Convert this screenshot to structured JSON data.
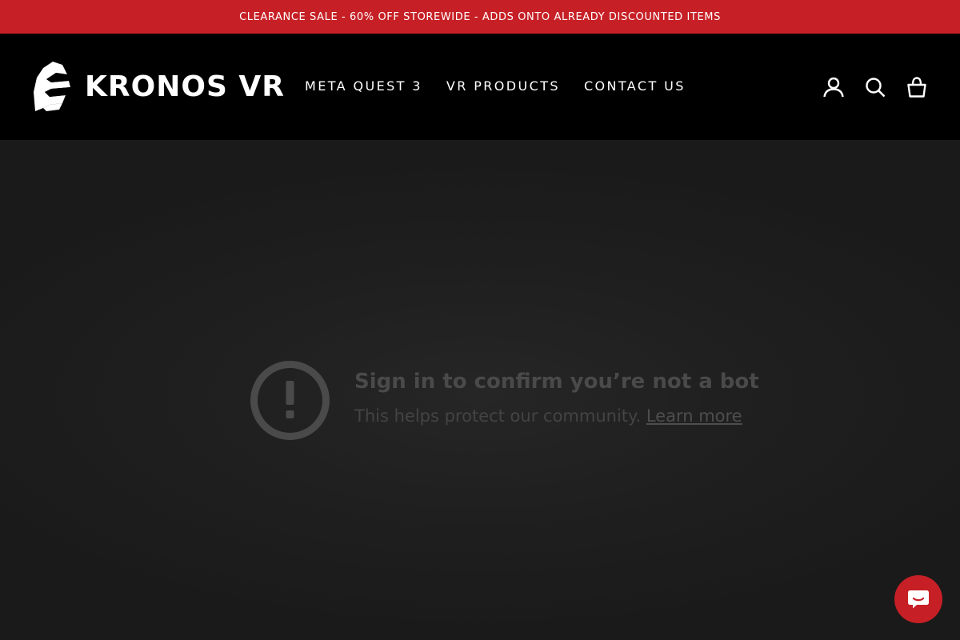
{
  "announcement": {
    "text": "CLEARANCE SALE - 60% OFF STOREWIDE - ADDS ONTO ALREADY DISCOUNTED ITEMS"
  },
  "header": {
    "logo_text": "KRONOS VR",
    "nav": [
      {
        "label": "META QUEST 3"
      },
      {
        "label": "VR PRODUCTS"
      },
      {
        "label": "CONTACT US"
      }
    ],
    "icons": {
      "account": "user-icon",
      "search": "search-icon",
      "cart": "cart-icon"
    }
  },
  "embed": {
    "icon": "alert-icon",
    "title": "Sign in to confirm you’re not a bot",
    "subtitle": "This helps protect our community.",
    "link": "Learn more"
  },
  "chat": {
    "icon": "chat-icon"
  },
  "colors": {
    "announcement_bg": "#c62026",
    "header_bg": "#000000",
    "page_bg": "#1a1a1a",
    "chat_bg": "#c62026"
  }
}
